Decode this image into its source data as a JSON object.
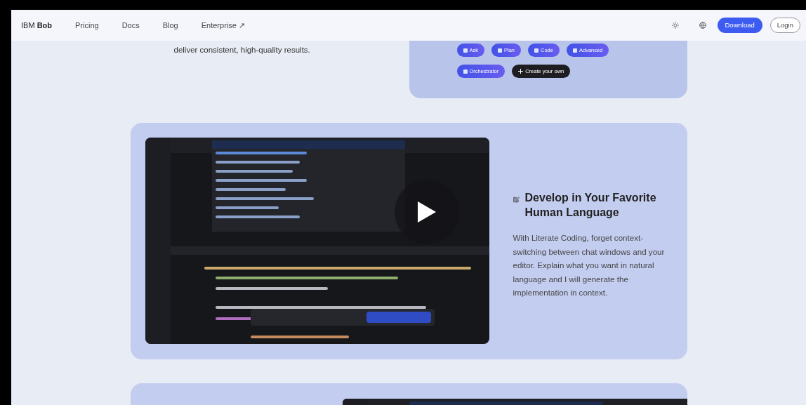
{
  "nav": {
    "brand": "IBM **Bob**",
    "links": [
      {
        "label": "Pricing"
      },
      {
        "label": "Docs"
      },
      {
        "label": "Blog"
      },
      {
        "label": "Enterprise ↗"
      }
    ],
    "buttons": [
      {
        "label": "Download",
        "kind": "primary"
      },
      {
        "label": "Login",
        "kind": "outline"
      }
    ]
  },
  "intro_text": "deliver consistent, high-quality results.",
  "modes": [
    {
      "label": "Ask",
      "kind": "mode"
    },
    {
      "label": "Plan",
      "kind": "mode"
    },
    {
      "label": "Code",
      "kind": "mode"
    },
    {
      "label": "Advanced",
      "kind": "mode"
    },
    {
      "label": "Orchestrator",
      "kind": "mode"
    },
    {
      "label": "Create your own",
      "kind": "create"
    }
  ],
  "feature": {
    "title": "Develop in Your Favorite Human Language",
    "body": "With Literate Coding, forget context-switching between chat windows and your editor. Explain what you want in natural language and I will generate the implementation in context."
  }
}
